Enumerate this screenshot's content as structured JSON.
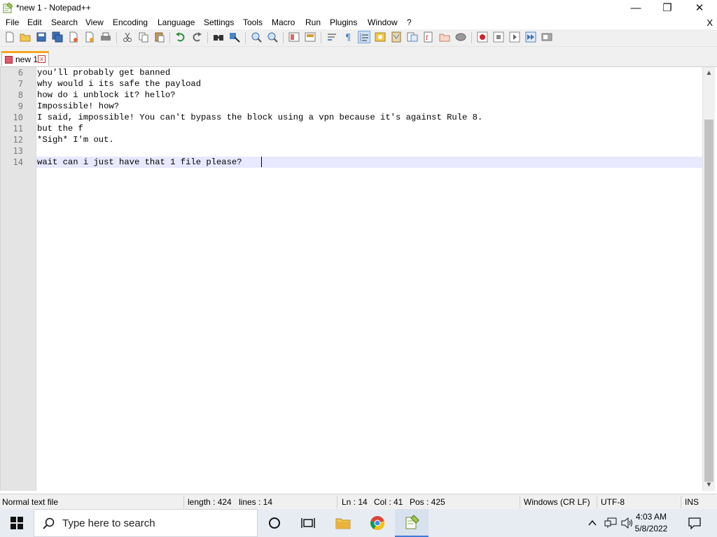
{
  "window": {
    "title": "*new 1 - Notepad++",
    "minimize_glyph": "—",
    "maximize_glyph": "❐",
    "close_glyph": "✕"
  },
  "menu": {
    "items": [
      "File",
      "Edit",
      "Search",
      "View",
      "Encoding",
      "Language",
      "Settings",
      "Tools",
      "Macro",
      "Run",
      "Plugins",
      "Window",
      "?"
    ],
    "close_doc": "X"
  },
  "toolbar": {
    "icons": [
      "new-file-icon",
      "open-file-icon",
      "save-icon",
      "save-all-icon",
      "close-icon",
      "close-all-icon",
      "print-icon",
      "cut-icon",
      "copy-icon",
      "paste-icon",
      "undo-icon",
      "redo-icon",
      "find-icon",
      "replace-icon",
      "zoom-in-icon",
      "zoom-out-icon",
      "sync-vertical-icon",
      "sync-horizontal-icon",
      "word-wrap-icon",
      "show-all-chars-icon",
      "indent-guide-icon",
      "udl-icon",
      "doc-map-icon",
      "function-list-icon",
      "folder-workspace-icon",
      "monitoring-icon",
      "record-macro-icon",
      "stop-record-icon",
      "play-macro-icon",
      "run-macro-multiple-icon",
      "save-macro-icon"
    ]
  },
  "tabs": [
    {
      "label": "new 1",
      "close_glyph": "x"
    }
  ],
  "editor": {
    "lines": [
      {
        "num": "6",
        "text": "you'll probably get banned"
      },
      {
        "num": "7",
        "text": "why would i its safe the payload"
      },
      {
        "num": "8",
        "text": "how do i unblock it? hello?"
      },
      {
        "num": "9",
        "text": "Impossible! how?"
      },
      {
        "num": "10",
        "text": "I said, impossible! You can't bypass the block using a vpn because it's against Rule 8."
      },
      {
        "num": "11",
        "text": "but the f"
      },
      {
        "num": "12",
        "text": "*Sigh* I'm out."
      },
      {
        "num": "13",
        "text": ""
      },
      {
        "num": "14",
        "text": "wait can i just have that 1 file please?"
      }
    ],
    "current_line_color": "#e8e8ff"
  },
  "scrollbar": {
    "up_glyph": "▲",
    "down_glyph": "▼"
  },
  "status": {
    "file_type": "Normal text file",
    "length": "length : 424",
    "lines": "lines : 14",
    "ln": "Ln : 14",
    "col": "Col : 41",
    "pos": "Pos : 425",
    "eol": "Windows (CR LF)",
    "encoding": "UTF-8",
    "mode": "INS"
  },
  "taskbar": {
    "search_placeholder": "Type here to search",
    "time": "4:03 AM",
    "date": "5/8/2022",
    "accent_color": "#3f7bd8"
  }
}
